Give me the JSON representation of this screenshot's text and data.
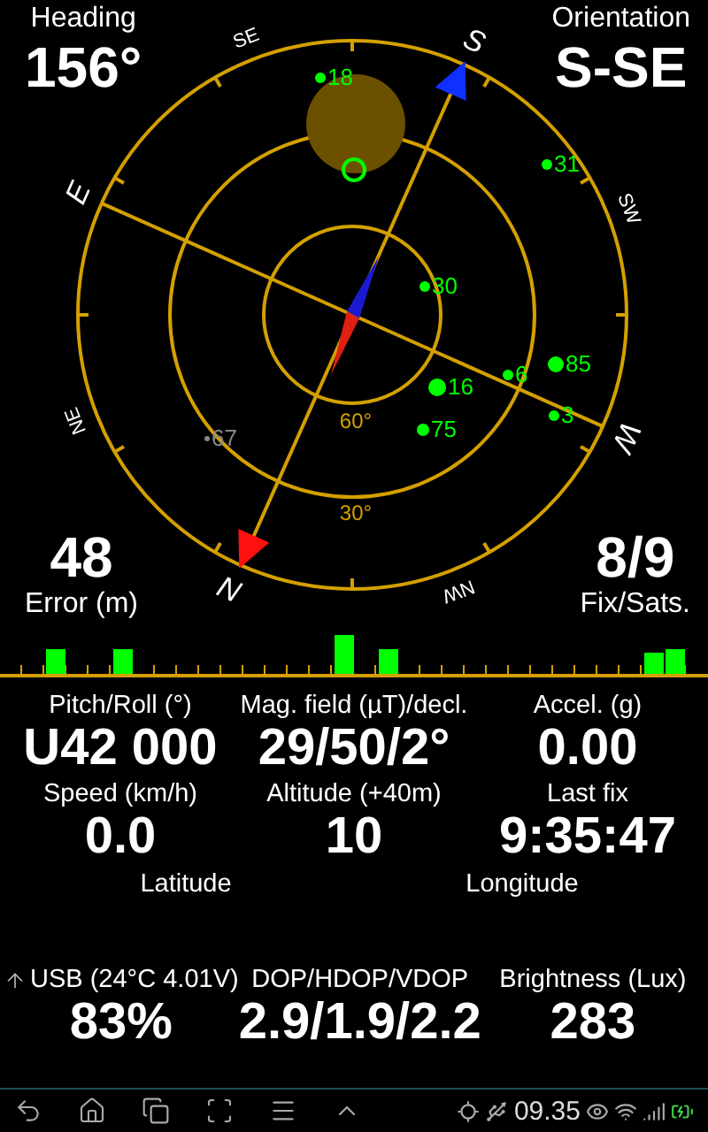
{
  "heading": {
    "label": "Heading",
    "value": "156°"
  },
  "orientation": {
    "label": "Orientation",
    "value": "S-SE"
  },
  "compass": {
    "directions": [
      "N",
      "NE",
      "E",
      "SE",
      "S",
      "SW",
      "W",
      "NW"
    ],
    "elevation_labels": [
      "60°",
      "30°"
    ]
  },
  "satellites": [
    {
      "label": "18",
      "in_fix": true
    },
    {
      "label": "31",
      "in_fix": true
    },
    {
      "label": "30",
      "in_fix": true
    },
    {
      "label": "85",
      "in_fix": true
    },
    {
      "label": "6",
      "in_fix": true
    },
    {
      "label": "16",
      "in_fix": true
    },
    {
      "label": "3",
      "in_fix": true
    },
    {
      "label": "75",
      "in_fix": true
    },
    {
      "label": "67",
      "in_fix": false
    }
  ],
  "error": {
    "label": "Error (m)",
    "value": "48"
  },
  "fix": {
    "label": "Fix/Sats.",
    "value": "8/9"
  },
  "stat_rows": [
    [
      {
        "label": "Pitch/Roll (°)",
        "value": "U42 000",
        "kind": "plain"
      },
      {
        "label": "Mag. field (µT)/decl.",
        "value": "29/50/2°",
        "kind": "plain"
      },
      {
        "label": "Accel. (g)",
        "value": "0.00",
        "kind": "plain"
      }
    ],
    [
      {
        "label": "Speed (km/h)",
        "value": "0.0",
        "kind": "plain"
      },
      {
        "label": "Altitude (+40m)",
        "value": "10",
        "kind": "plain"
      },
      {
        "label": "Last fix",
        "value": "9:35:47",
        "kind": "plain"
      }
    ]
  ],
  "coordinates": [
    {
      "label": "Latitude"
    },
    {
      "label": "Longitude"
    }
  ],
  "bottom_stats": [
    {
      "label": "USB (24°C 4.01V)",
      "value": "83%",
      "kind": "battery"
    },
    {
      "label": "DOP/HDOP/VDOP",
      "value": "2.9/1.9/2.2",
      "kind": "plain"
    },
    {
      "label": "Brightness (Lux)",
      "value": "283",
      "kind": "plain"
    }
  ],
  "status_bar": {
    "time": "09.35"
  }
}
